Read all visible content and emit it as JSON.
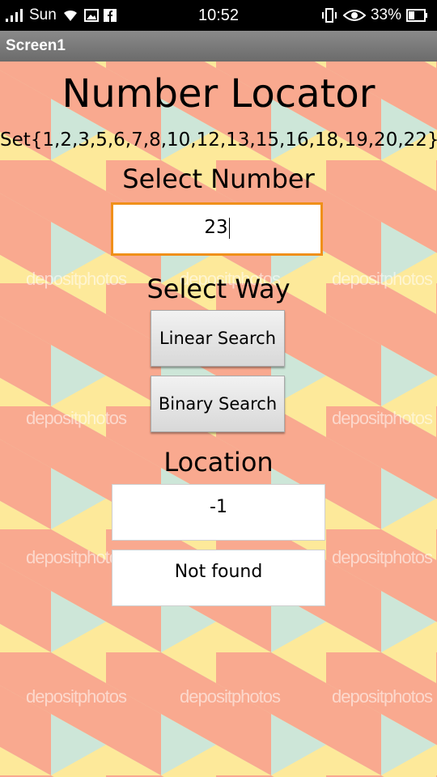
{
  "status_bar": {
    "carrier": "Sun",
    "time": "10:52",
    "battery": "33%"
  },
  "title_bar": {
    "title": "Screen1"
  },
  "watermark": {
    "text": "depositphotos"
  },
  "main": {
    "title": "Number Locator",
    "set_text": "Set{1,2,3,5,6,7,8,10,12,13,15,16,18,19,20,22}",
    "select_number_label": "Select Number",
    "number_input_value": "23",
    "select_way_label": "Select Way",
    "linear_search_button": "Linear Search",
    "binary_search_button": "Binary Search",
    "location_label": "Location",
    "location_value": "-1",
    "result_message": "Not found"
  },
  "colors": {
    "salmon": "#f9a98f",
    "yellow": "#fde99a",
    "mint": "#cde6d8",
    "input_focus": "#f0901a"
  }
}
